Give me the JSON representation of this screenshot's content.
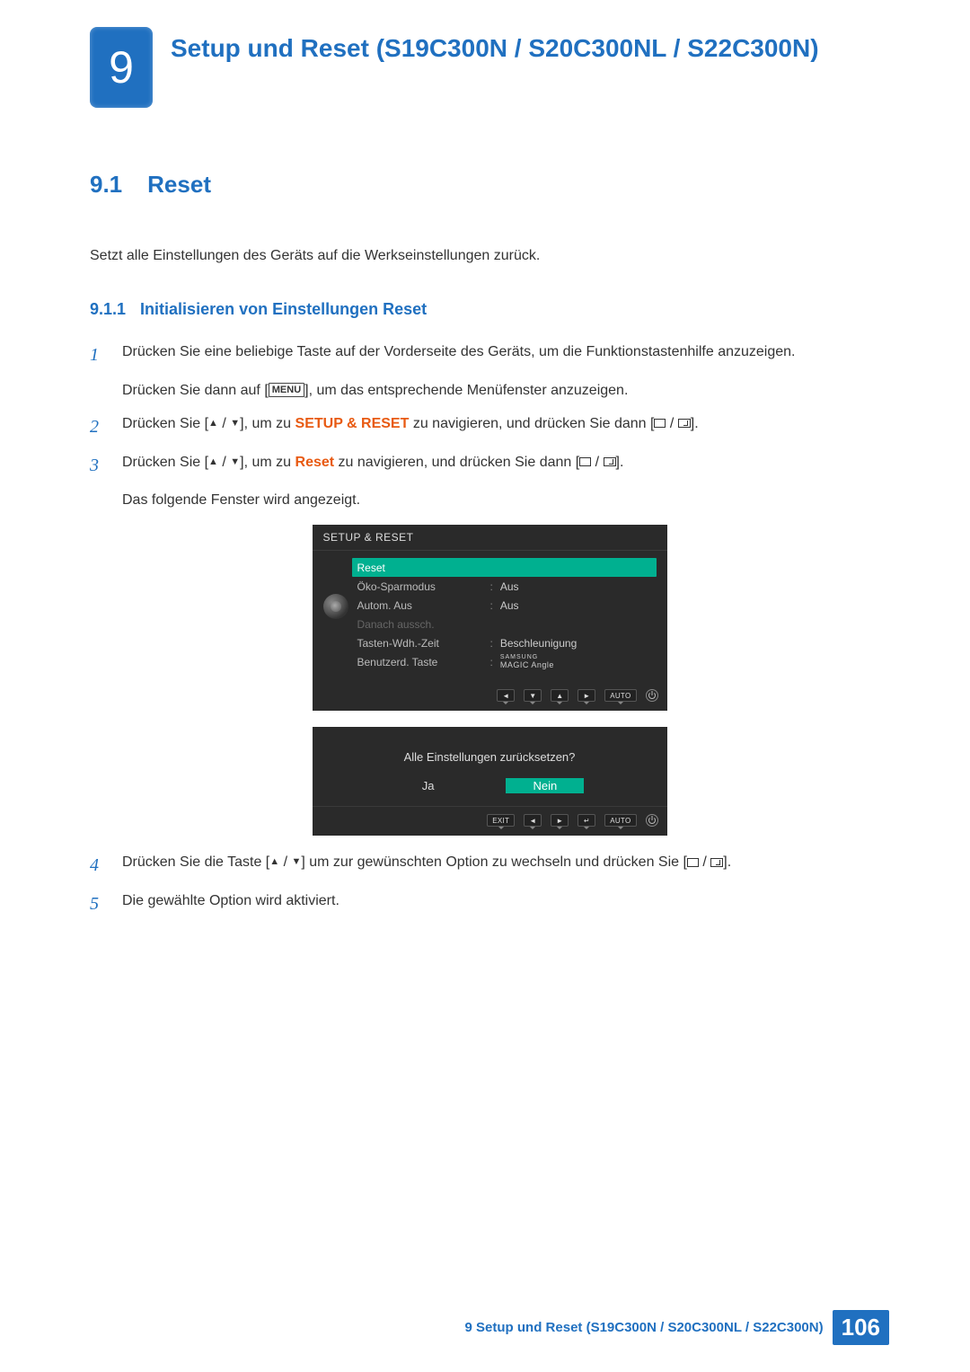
{
  "chapter": {
    "num": "9",
    "title": "Setup und Reset (S19C300N / S20C300NL / S22C300N)"
  },
  "section": {
    "num": "9.1",
    "title": "Reset"
  },
  "desc": "Setzt alle Einstellungen des Geräts auf die Werkseinstellungen zurück.",
  "subsection": {
    "num": "9.1.1",
    "title": "Initialisieren von Einstellungen Reset"
  },
  "steps": {
    "s1": {
      "n": "1",
      "a": "Drücken Sie eine beliebige Taste auf der Vorderseite des Geräts, um die Funktionstastenhilfe anzuzeigen.",
      "b_pre": "Drücken Sie dann auf [",
      "b_menu": "MENU",
      "b_post": "], um das entsprechende Menüfenster anzuzeigen."
    },
    "s2": {
      "n": "2",
      "pre": "Drücken Sie [",
      "mid": "], um zu ",
      "kw": "SETUP & RESET",
      "mid2": " zu navigieren, und drücken Sie dann [",
      "end": "]."
    },
    "s3": {
      "n": "3",
      "pre": "Drücken Sie [",
      "mid": "], um zu ",
      "kw": "Reset",
      "mid2": " zu navigieren, und drücken Sie dann [",
      "end": "].",
      "sub": "Das folgende Fenster wird angezeigt."
    },
    "s4": {
      "n": "4",
      "pre": "Drücken Sie die Taste [",
      "mid": "] um zur gewünschten Option zu wechseln und drücken Sie [",
      "end": "]."
    },
    "s5": {
      "n": "5",
      "text": "Die gewählte Option wird aktiviert."
    }
  },
  "osd1": {
    "title": "SETUP & RESET",
    "rows": [
      {
        "label": "Reset",
        "hl": true
      },
      {
        "label": "Öko-Sparmodus",
        "colon": ":",
        "val": "Aus"
      },
      {
        "label": "Autom. Aus",
        "colon": ":",
        "val": "Aus"
      },
      {
        "label": "Danach aussch.",
        "dim": true
      },
      {
        "label": "Tasten-Wdh.-Zeit",
        "colon": ":",
        "val": "Beschleunigung"
      },
      {
        "label": "Benutzerd. Taste",
        "colon": ":",
        "val_special": true,
        "brand": "SAMSUNG",
        "magic": "MAGIC",
        "angle": " Angle"
      }
    ],
    "auto": "AUTO"
  },
  "osd2": {
    "question": "Alle Einstellungen zurücksetzen?",
    "yes": "Ja",
    "no": "Nein",
    "exit": "EXIT",
    "auto": "AUTO"
  },
  "footer": {
    "text": "9 Setup und Reset (S19C300N / S20C300NL / S22C300N)",
    "page": "106"
  }
}
